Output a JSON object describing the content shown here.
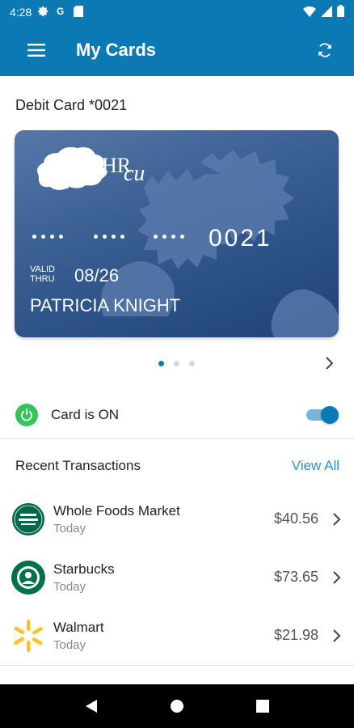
{
  "status_bar": {
    "time": "4:28",
    "icons": [
      "gear-icon",
      "google-g-icon",
      "sd-card-icon",
      "wifi-icon",
      "signal-icon",
      "battery-icon"
    ]
  },
  "app_bar": {
    "title": "My Cards",
    "menu_icon": "menu-icon",
    "sync_icon": "sync-icon"
  },
  "card_section": {
    "title": "Debit Card *0021",
    "card": {
      "brand": "HR",
      "brand_script": "cu",
      "number_last4": "0021",
      "valid_label_line1": "VALID",
      "valid_label_line2": "THRU",
      "valid_thru": "08/26",
      "holder": "PATRICIA KNIGHT",
      "card_color": "#2f5389"
    },
    "pager": {
      "count": 3,
      "active": 0
    }
  },
  "card_status": {
    "label": "Card is ON",
    "enabled": true,
    "accent": "#33c45a"
  },
  "transactions": {
    "title": "Recent Transactions",
    "view_all": "View All",
    "items": [
      {
        "merchant": "Whole Foods Market",
        "date": "Today",
        "amount": "$40.56",
        "logo": "whole-foods-logo"
      },
      {
        "merchant": "Starbucks",
        "date": "Today",
        "amount": "$73.65",
        "logo": "starbucks-logo"
      },
      {
        "merchant": "Walmart",
        "date": "Today",
        "amount": "$21.98",
        "logo": "walmart-logo"
      }
    ]
  },
  "colors": {
    "primary": "#0b7ab4",
    "link": "#2f8ed0",
    "on": "#33c45a"
  }
}
